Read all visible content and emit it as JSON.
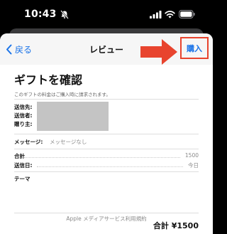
{
  "status_bar": {
    "time": "10:43"
  },
  "nav": {
    "back_label": "戻る",
    "title": "レビュー",
    "buy_label": "購入"
  },
  "review": {
    "heading": "ギフトを確認",
    "billing_note": "このギフトの料金はご購入時に請求されます。",
    "fields": {
      "recipient_label": "送信先:",
      "sender_label": "送信者:",
      "giver_label": "贈り主:",
      "message_label": "メッセージ:",
      "message_value": "メッセージなし",
      "subtotal_label": "合計",
      "subtotal_value": "1500",
      "send_date_label": "送信日:",
      "send_date_value": "今日",
      "theme_label": "テーマ"
    },
    "total_text": "合計 ¥1500"
  },
  "footer": {
    "terms_link": "Apple メディアサービス利用規約"
  },
  "colors": {
    "accent": "#1a73e8",
    "annotation_red": "#e8442e",
    "redaction_gray": "#c4c4c4"
  },
  "icons": [
    "mute-icon",
    "signal-icon",
    "wifi-icon",
    "battery-icon",
    "chevron-left-icon",
    "arrow-annotation"
  ]
}
